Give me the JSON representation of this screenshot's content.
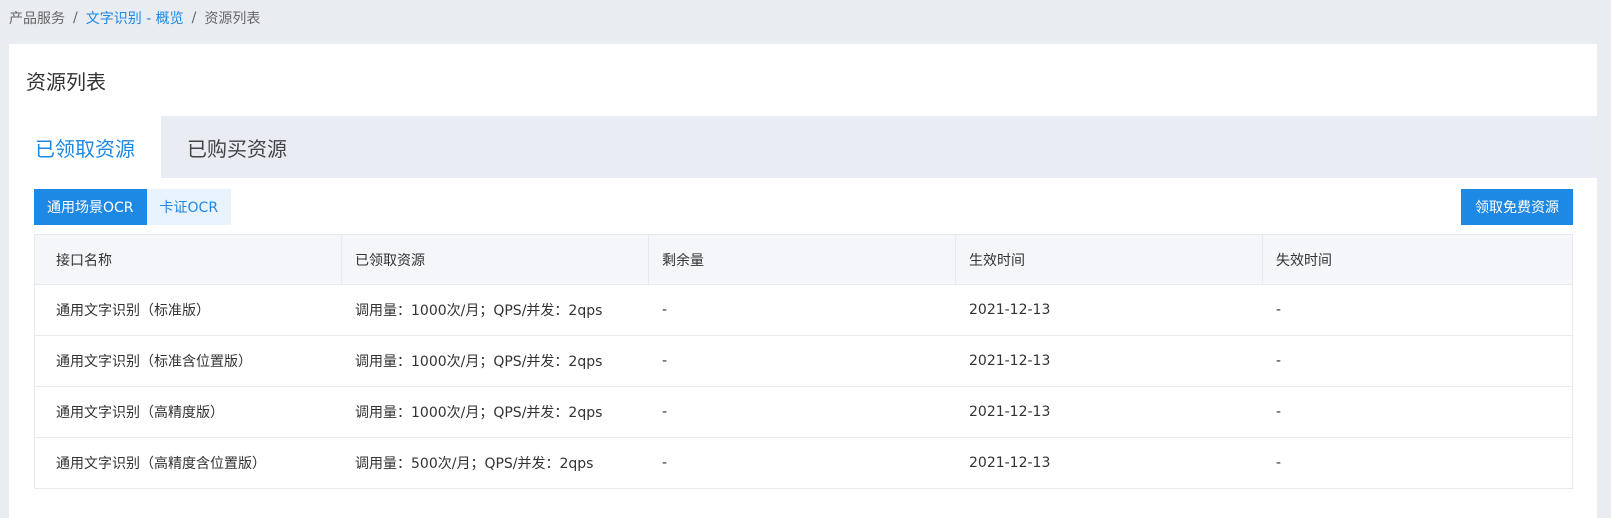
{
  "breadcrumb": {
    "items": [
      "产品服务",
      "文字识别 - 概览",
      "资源列表"
    ],
    "separator": "/"
  },
  "panel": {
    "title": "资源列表"
  },
  "tabs": [
    {
      "label": "已领取资源",
      "active": true
    },
    {
      "label": "已购买资源",
      "active": false
    }
  ],
  "subtabs": [
    {
      "label": "通用场景OCR",
      "active": true
    },
    {
      "label": "卡证OCR",
      "active": false
    }
  ],
  "actions": {
    "claim_free_label": "领取免费资源"
  },
  "table": {
    "headers": [
      "接口名称",
      "已领取资源",
      "剩余量",
      "生效时间",
      "失效时间"
    ],
    "rows": [
      [
        "通用文字识别（标准版）",
        "调用量：1000次/月；QPS/并发：2qps",
        "-",
        "2021-12-13",
        "-"
      ],
      [
        "通用文字识别（标准含位置版）",
        "调用量：1000次/月；QPS/并发：2qps",
        "-",
        "2021-12-13",
        "-"
      ],
      [
        "通用文字识别（高精度版）",
        "调用量：1000次/月；QPS/并发：2qps",
        "-",
        "2021-12-13",
        "-"
      ],
      [
        "通用文字识别（高精度含位置版）",
        "调用量：500次/月；QPS/并发：2qps",
        "-",
        "2021-12-13",
        "-"
      ]
    ]
  },
  "colors": {
    "accent": "#1e88e5",
    "background": "#e9ecf1",
    "tab_bar": "#e9ecf3",
    "table_header": "#f4f6f9"
  }
}
